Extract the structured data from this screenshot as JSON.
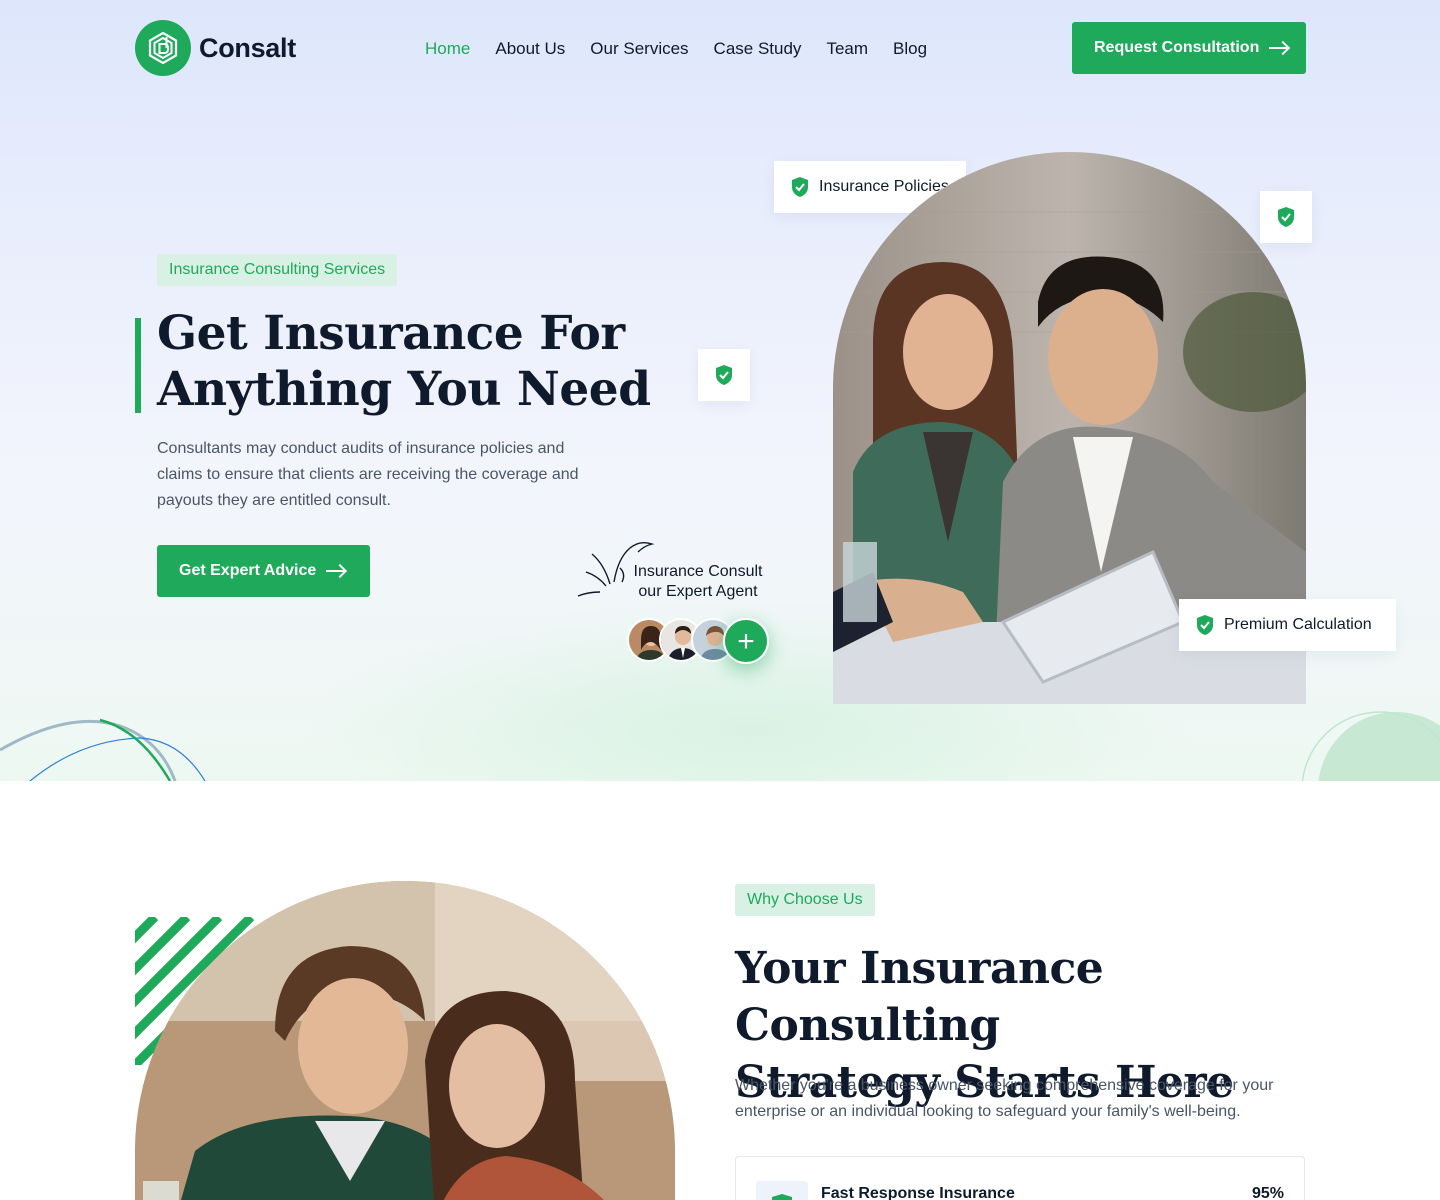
{
  "brand": {
    "name": "Consalt"
  },
  "nav": {
    "items": [
      {
        "label": "Home",
        "active": true
      },
      {
        "label": "About Us",
        "active": false
      },
      {
        "label": "Our Services",
        "active": false
      },
      {
        "label": "Case Study",
        "active": false
      },
      {
        "label": "Team",
        "active": false
      },
      {
        "label": "Blog",
        "active": false
      }
    ],
    "cta_label": "Request Consultation"
  },
  "hero": {
    "tag": "Insurance Consulting Services",
    "title_line1": "Get Insurance For",
    "title_line2": "Anything You Need",
    "description": "Consultants may conduct audits of insurance policies and claims to ensure that clients are receiving the coverage and payouts they are entitled consult.",
    "cta_label": "Get Expert Advice",
    "agent_line1": "Insurance Consult",
    "agent_line2": "our Expert Agent",
    "agent_plus": "+",
    "badges": {
      "policies": "Insurance Policies",
      "premium": "Premium Calculation"
    }
  },
  "why": {
    "tag": "Why Choose Us",
    "title_line1": "Your Insurance Consulting",
    "title_line2": "Strategy Starts Here",
    "description": "Whether you're a business owner seeking comprehensive coverage for your enterprise or an individual looking to safeguard your family's well-being.",
    "progress": [
      {
        "label": "Fast Response Insurance",
        "value_text": "95%",
        "percent": 95
      }
    ]
  },
  "colors": {
    "accent": "#1fa95b",
    "heading": "#0f1b2d",
    "body_text": "#4a5566",
    "tag_bg": "#d9f1e4"
  },
  "icons": {
    "logo": "logo-mark-icon",
    "arrow": "arrow-right-icon",
    "shield": "shield-check-icon",
    "plus": "plus-icon"
  }
}
